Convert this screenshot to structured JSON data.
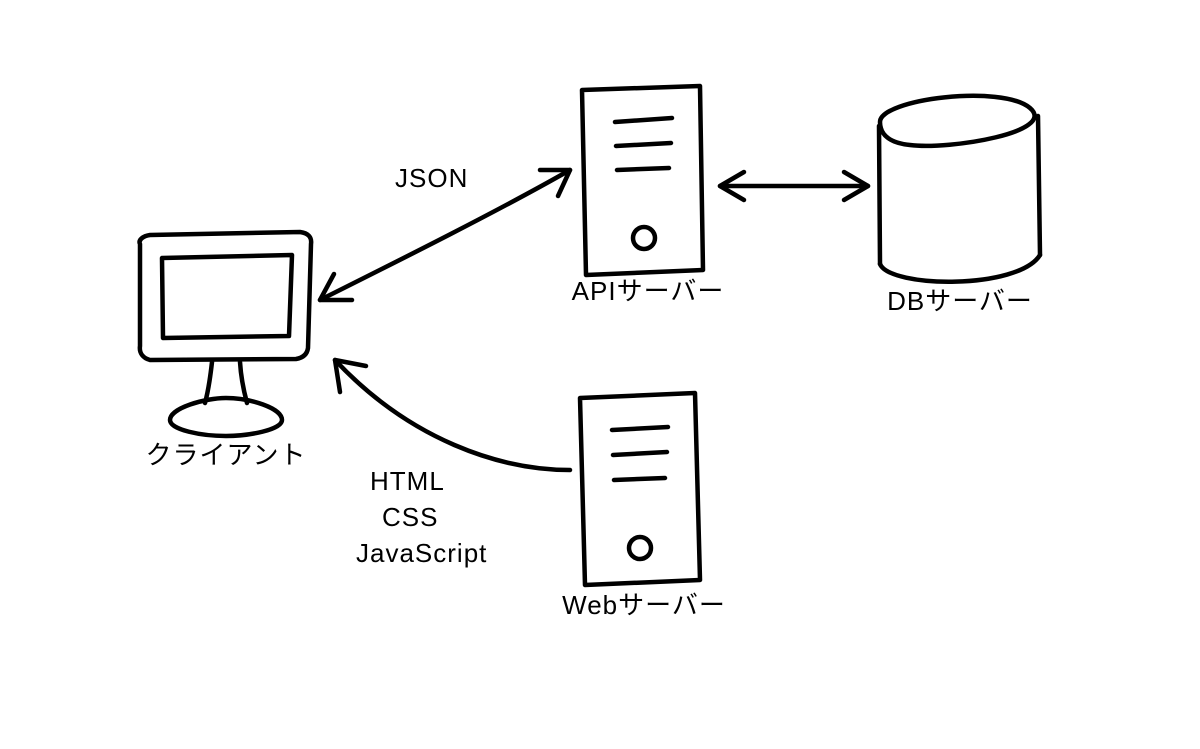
{
  "nodes": {
    "client": {
      "label": "クライアント"
    },
    "api_server": {
      "label": "APIサーバー"
    },
    "db_server": {
      "label": "DBサーバー"
    },
    "web_server": {
      "label": "Webサーバー"
    }
  },
  "edges": {
    "client_api": {
      "label": "JSON",
      "direction": "bidirectional"
    },
    "api_db": {
      "direction": "bidirectional"
    },
    "web_client": {
      "label_lines": [
        "HTML",
        "CSS",
        "JavaScript"
      ],
      "direction": "to-client"
    }
  }
}
